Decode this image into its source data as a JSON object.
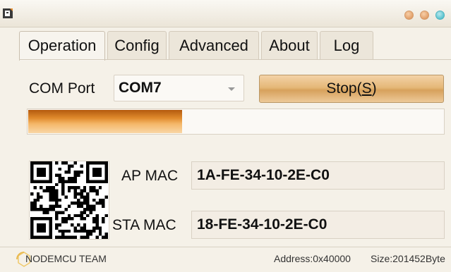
{
  "window": {
    "icon": "app-icon",
    "controls": [
      "minimize-button",
      "maximize-button",
      "close-button"
    ]
  },
  "tabs": [
    {
      "label": "Operation",
      "active": true
    },
    {
      "label": "Config",
      "active": false
    },
    {
      "label": "Advanced",
      "active": false
    },
    {
      "label": "About",
      "active": false
    },
    {
      "label": "Log",
      "active": false
    }
  ],
  "operation": {
    "com_port_label": "COM Port",
    "com_port_value": "COM7",
    "stop_label": "Stop(",
    "stop_mnemonic": "S",
    "stop_suffix": ")",
    "progress_fraction": 0.37,
    "ap_mac_label": "AP MAC",
    "ap_mac_value": "1A-FE-34-10-2E-C0",
    "sta_mac_label": "STA MAC",
    "sta_mac_value": "18-FE-34-10-2E-C0"
  },
  "status": {
    "team": "NODEMCU TEAM",
    "address": "Address:0x40000",
    "size": "Size:201452Byte"
  },
  "colors": {
    "background": "#f5f1e8",
    "button_accent": "#e5b878",
    "progress_accent": "#e08a2c",
    "window_button": "#e2a06a",
    "window_button_close": "#5cc3cf"
  }
}
